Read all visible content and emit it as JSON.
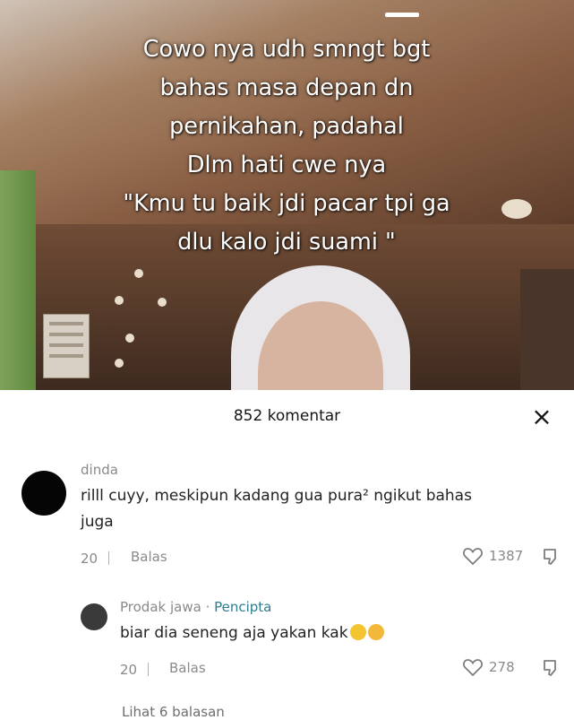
{
  "video": {
    "overlay_lines": [
      "Cowo nya udh smngt bgt",
      "bahas masa depan dn",
      "pernikahan, padahal",
      "Dlm hati cwe nya",
      "\"Kmu tu baik jdi pacar tpi ga",
      "dlu kalo jdi suami \""
    ]
  },
  "comments_sheet": {
    "title": "852 komentar",
    "close_icon": "×",
    "comments": [
      {
        "username": "dinda",
        "text_line1": "rilll cuyy, meskipun kadang gua pura² ngikut bahas",
        "text_line2": "juga",
        "date": "20 ｜",
        "reply_label": "Balas",
        "likes": "1387"
      }
    ],
    "reply": {
      "username": "Prodak jawa",
      "separator": " · ",
      "author_tag": "Pencipta",
      "text": "biar dia seneng aja yakan kak",
      "emoji": [
        "sad-face-emoji",
        "crying-face-emoji"
      ],
      "date": "20 ｜",
      "reply_label": "Balas",
      "likes": "278"
    },
    "view_replies": "Lihat 6 balasan"
  },
  "colors": {
    "accent": "#2e7d8c",
    "muted": "#8a8a8a",
    "sheet_bg": "#ffffff"
  }
}
